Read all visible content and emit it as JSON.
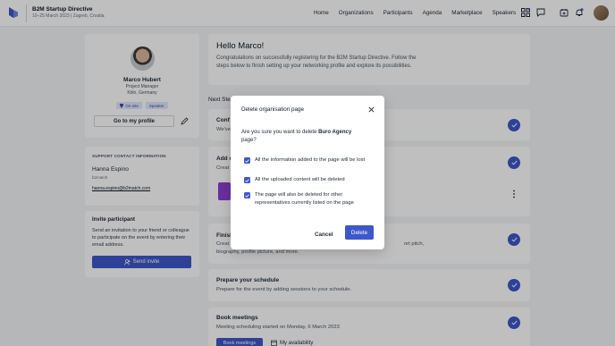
{
  "header": {
    "event_title": "B2M Startup Directive",
    "event_subtitle": "10–25 March 2023 | Zagreb, Croatia",
    "nav": [
      "Home",
      "Organizations",
      "Participants",
      "Agenda",
      "Marketplace",
      "Speakers"
    ],
    "icons": [
      "grid-apps-icon",
      "chat-icon",
      "calendar-add-icon",
      "bell-icon",
      "user-avatar"
    ]
  },
  "profile": {
    "name": "Marco Hubert",
    "role": "Project Manager",
    "city": "Köln, Germany",
    "badges": [
      "On-site",
      "Speaker"
    ],
    "profile_button": "Go to my profile"
  },
  "support": {
    "heading": "SUPPORT CONTACT INFORMATION",
    "name": "Hanna Espino",
    "org": "b2match",
    "email": "hanna.espino@b2match.com"
  },
  "invite": {
    "heading": "Invite participant",
    "text": "Send an invitation to your friend or colleague to participate on the event by entering their email address.",
    "button": "Send invite"
  },
  "hello": {
    "title": "Hello Marco!",
    "text": "Congratulations on successfully registering for the B2M Startup Directive. Follow the steps below to finish setting up your networking profile and explore its possibilities."
  },
  "next_steps_label": "Next Ste",
  "steps": {
    "confirm_title": "Conf",
    "confirm_text": "We've",
    "add_title": "Add o",
    "add_text": "Creat",
    "finish_title": "Finish",
    "finish_text_left": "Creat",
    "finish_text_right": "ort pitch,",
    "finish_text2": "biography, profile picture, and more.",
    "schedule_title": "Prepare your schedule",
    "schedule_text": "Prepare for the event by adding sessions to your schedule.",
    "meetings_title": "Book meetings",
    "meetings_text": "Meeting scheduling started on Monday, 6 March 2023",
    "meetings_button": "Book meetings",
    "availability": "My availability"
  },
  "modal": {
    "title": "Delete organisation page",
    "question_prefix": "Are you sure you want to delete ",
    "org_name": "Buro Agency",
    "question_suffix": " page?",
    "items": [
      "All the information added to the page will be lost",
      "All the uploaded content will be deleted",
      "The page will also be deleted for other representatives currently listed on the page"
    ],
    "cancel": "Cancel",
    "delete": "Delete"
  },
  "colors": {
    "accent": "#3d58c8",
    "org_logo": "#8b3fd6"
  }
}
